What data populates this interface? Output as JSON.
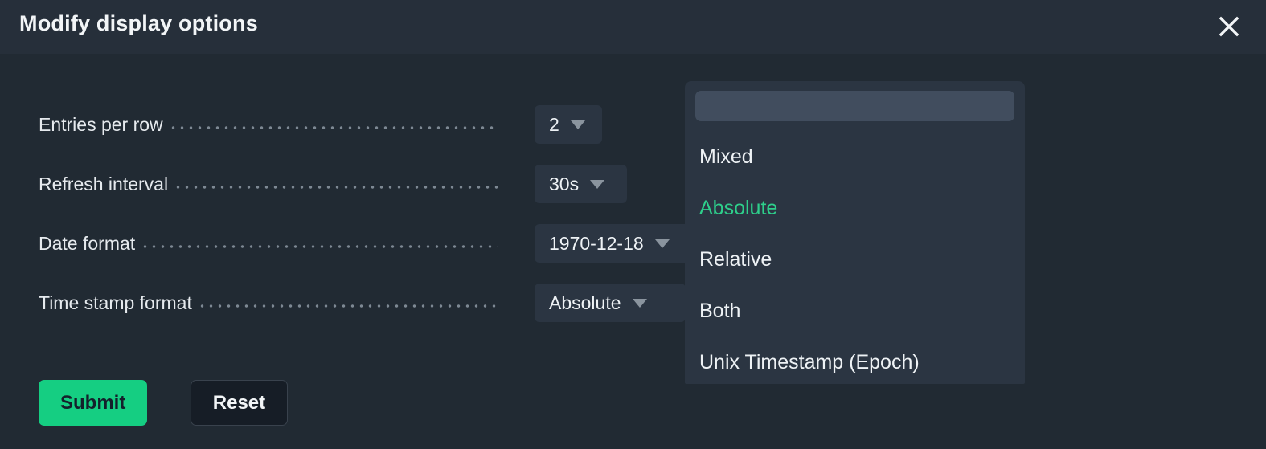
{
  "header": {
    "title": "Modify display options",
    "close_icon": "close-icon"
  },
  "form": {
    "rows": [
      {
        "label": "Entries per row",
        "value": "2",
        "icon": "chevron-down-icon",
        "field_width": 84
      },
      {
        "label": "Refresh interval",
        "value": "30s",
        "icon": "chevron-down-icon",
        "field_width": 115
      },
      {
        "label": "Date format",
        "value": "1970-12-18",
        "icon": "chevron-down-icon",
        "field_width": 218
      },
      {
        "label": "Time stamp format",
        "value": "Absolute",
        "icon": "chevron-down-icon",
        "field_width": 188
      }
    ]
  },
  "buttons": {
    "submit_label": "Submit",
    "reset_label": "Reset"
  },
  "dropdown": {
    "search_value": "",
    "search_placeholder": "",
    "options": [
      {
        "label": "Mixed",
        "selected": false
      },
      {
        "label": "Absolute",
        "selected": true
      },
      {
        "label": "Relative",
        "selected": false
      },
      {
        "label": "Both",
        "selected": false
      },
      {
        "label": "Unix Timestamp (Epoch)",
        "selected": false
      }
    ]
  },
  "colors": {
    "background": "#212a33",
    "header_background": "#262f3a",
    "field_background": "#2b3542",
    "accent_green": "#15ce82",
    "selected_option_green": "#2ecf8b",
    "search_background": "#414d5e",
    "text": "#eef2f5",
    "leader_dots": "#7d8893"
  }
}
